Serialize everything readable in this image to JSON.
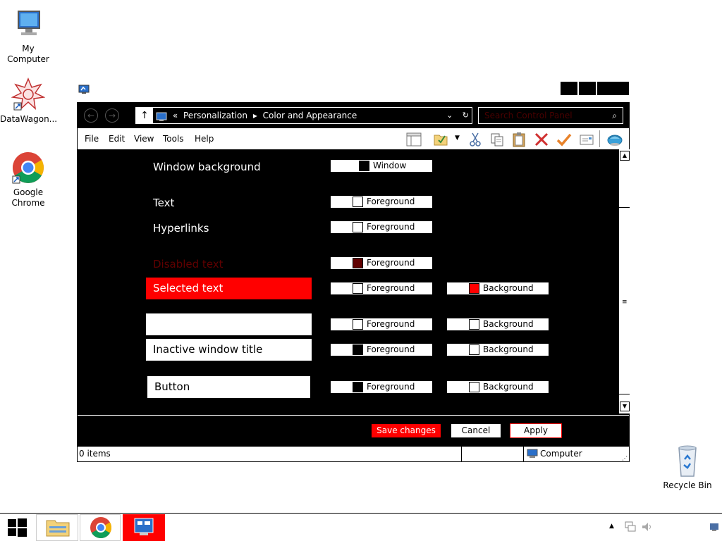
{
  "desktop": {
    "icons": [
      {
        "label": "My Computer"
      },
      {
        "label": "DataWagon..."
      },
      {
        "label": "Google Chrome"
      },
      {
        "label": "Recycle Bin"
      }
    ]
  },
  "window": {
    "breadcrumb": {
      "prefix": "«",
      "items": [
        "Personalization",
        "Color and Appearance"
      ]
    },
    "search_placeholder": "Search Control Panel",
    "menu": [
      "File",
      "Edit",
      "View",
      "Tools",
      "Help"
    ],
    "rows": [
      {
        "label": "Window background",
        "buttons": [
          {
            "text": "Window",
            "color": "#000000"
          }
        ]
      },
      {
        "label": "Text",
        "buttons": [
          {
            "text": "Foreground",
            "color": "#ffffff"
          }
        ]
      },
      {
        "label": "Hyperlinks",
        "buttons": [
          {
            "text": "Foreground",
            "color": "#ffffff"
          }
        ]
      },
      {
        "label": "Disabled text",
        "buttons": [
          {
            "text": "Foreground",
            "color": "#600000"
          }
        ]
      },
      {
        "label": "Selected text",
        "buttons": [
          {
            "text": "Foreground",
            "color": "#ffffff"
          },
          {
            "text": "Background",
            "color": "#ff0000"
          }
        ]
      },
      {
        "label": "",
        "buttons": [
          {
            "text": "Foreground",
            "color": "#ffffff"
          },
          {
            "text": "Background",
            "color": "#ffffff"
          }
        ]
      },
      {
        "label": "Inactive window title",
        "buttons": [
          {
            "text": "Foreground",
            "color": "#000000"
          },
          {
            "text": "Background",
            "color": "#ffffff"
          }
        ]
      },
      {
        "label": "Button",
        "buttons": [
          {
            "text": "Foreground",
            "color": "#000000"
          },
          {
            "text": "Background",
            "color": "#ffffff"
          }
        ]
      }
    ],
    "footer": {
      "save": "Save changes",
      "cancel": "Cancel",
      "apply": "Apply"
    },
    "status": {
      "items": "0 items",
      "location": "Computer"
    }
  },
  "colors": {
    "accent": "#ff0000",
    "disabled": "#600000"
  }
}
